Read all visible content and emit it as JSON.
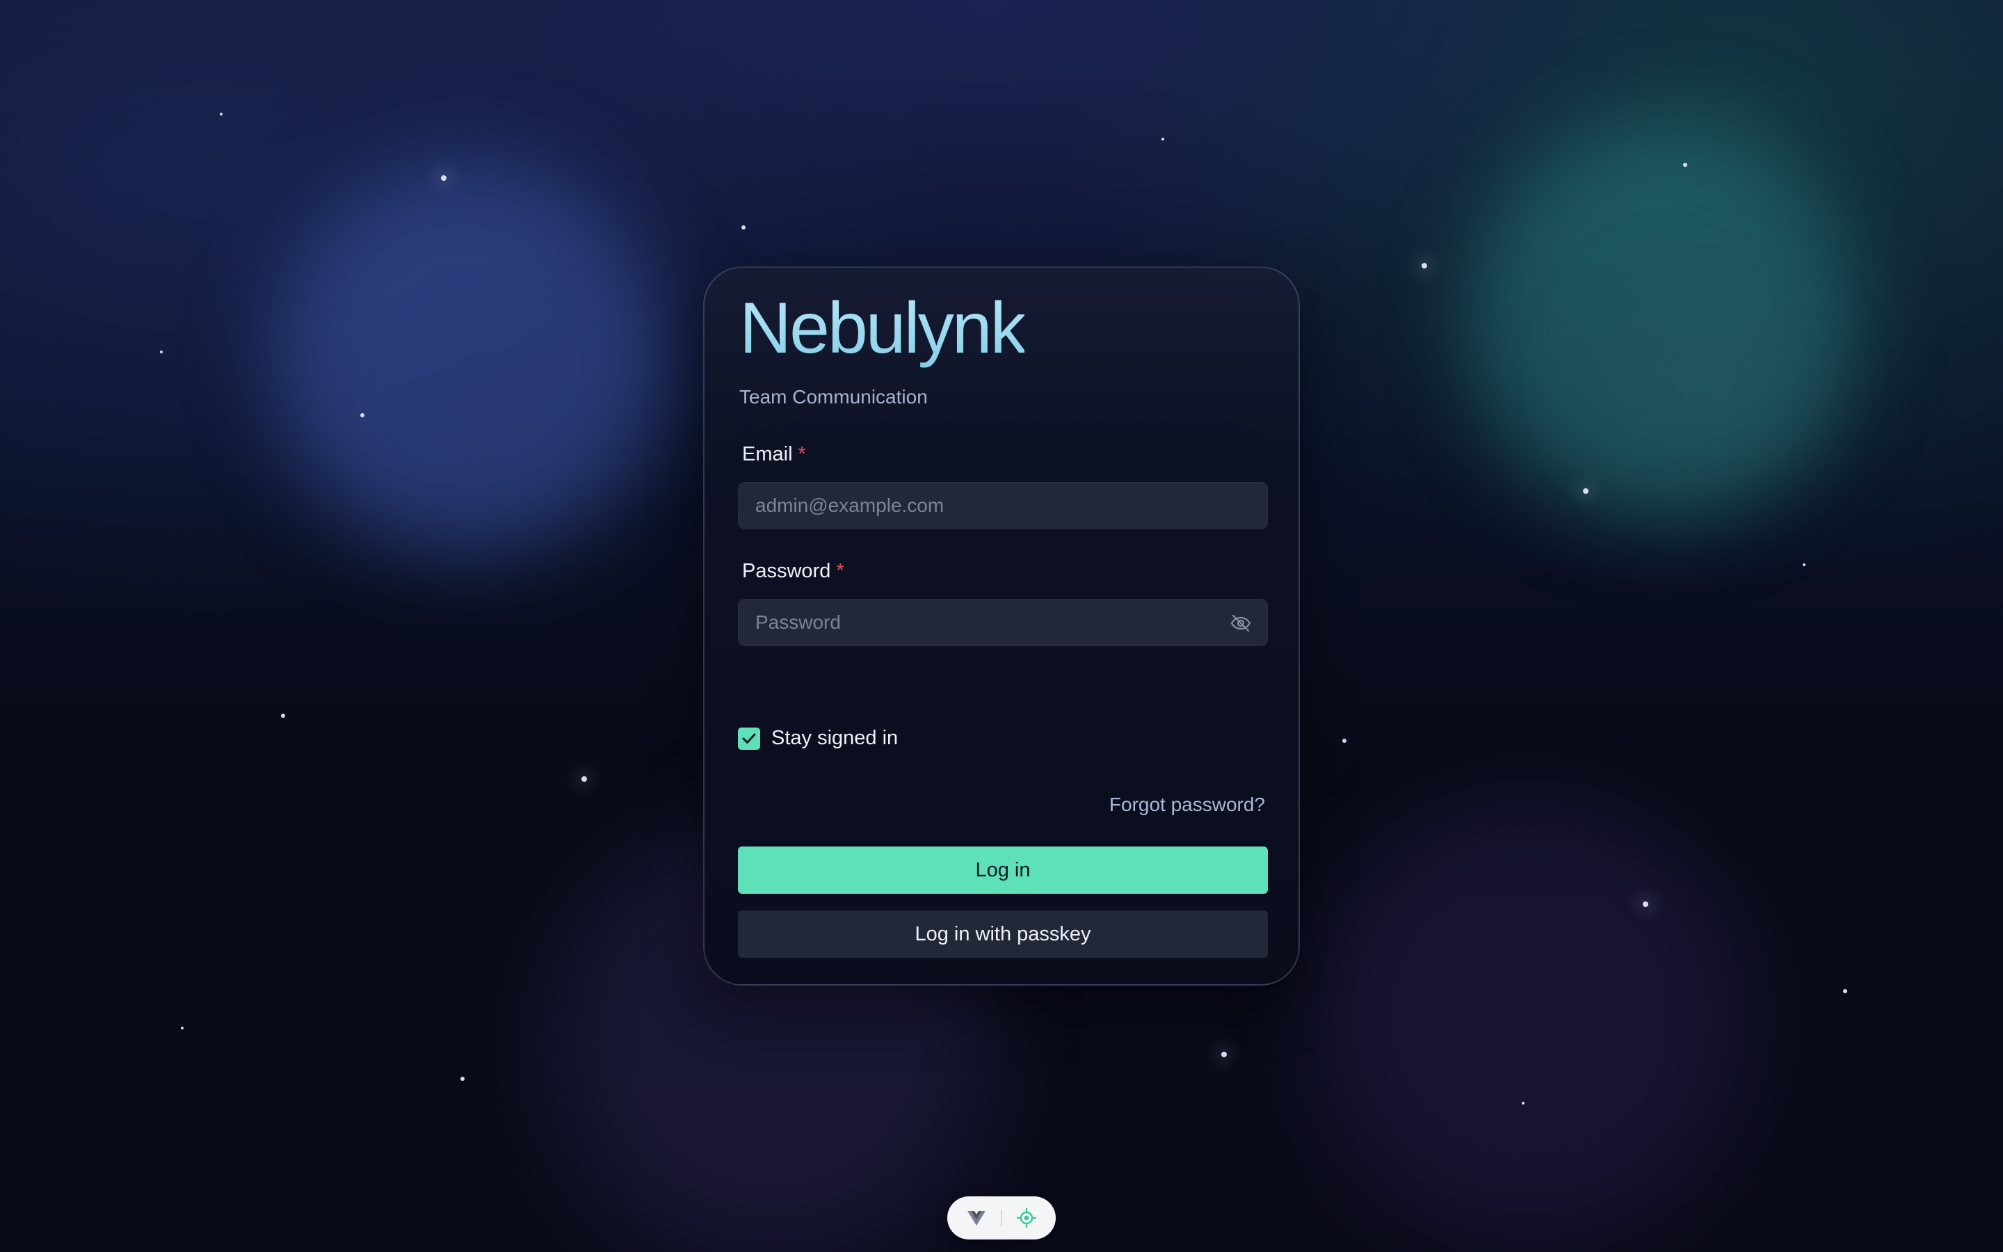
{
  "brand": {
    "name": "Nebulynk",
    "subtitle": "Team Communication"
  },
  "form": {
    "email": {
      "label": "Email",
      "required_mark": "*",
      "placeholder": "admin@example.com",
      "value": ""
    },
    "password": {
      "label": "Password",
      "required_mark": "*",
      "placeholder": "Password",
      "value": "",
      "toggle_icon": "eye-off-icon"
    },
    "remember": {
      "label": "Stay signed in",
      "checked": true
    },
    "forgot_label": "Forgot password?",
    "login_label": "Log in",
    "passkey_label": "Log in with passkey"
  },
  "dock": {
    "icons": [
      "vue-devtools-icon",
      "inspector-target-icon"
    ]
  },
  "colors": {
    "accent": "#5ee0b8",
    "brand_text": "#9fdcf0",
    "required": "#e14a5a",
    "field_bg": "#232839",
    "background": "#080b18"
  }
}
